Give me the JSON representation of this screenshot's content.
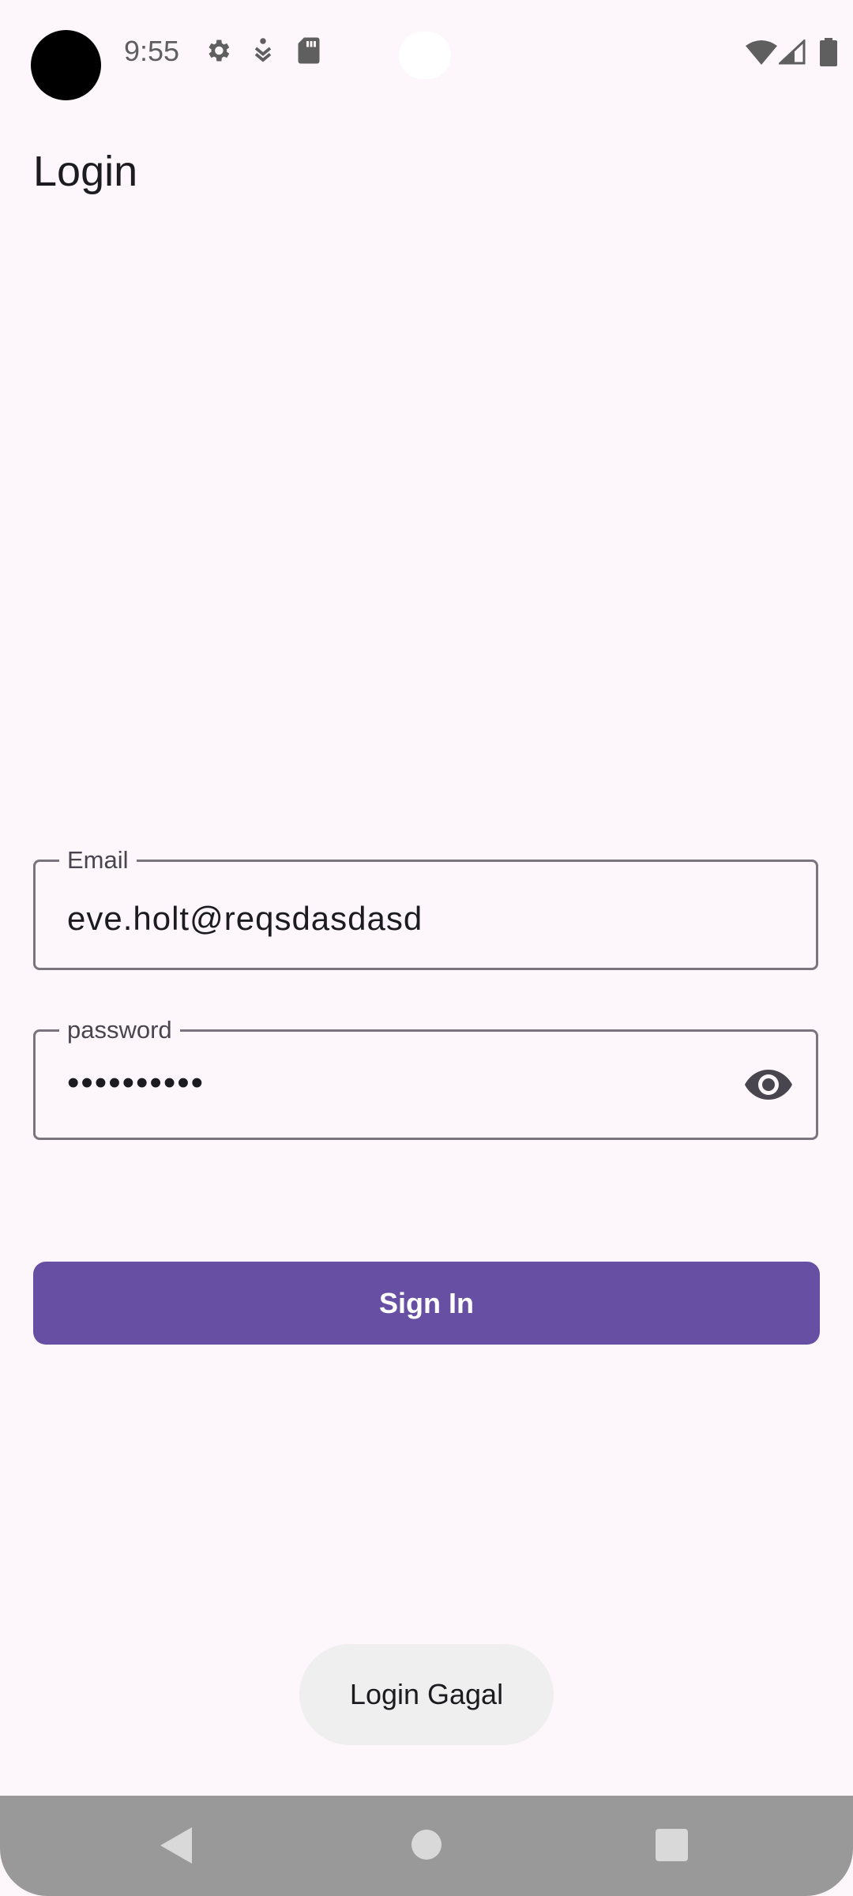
{
  "status_bar": {
    "time": "9:55",
    "icons_left": [
      "gear-icon",
      "accessibility-icon",
      "sd-card-icon"
    ],
    "icons_right": [
      "wifi-icon",
      "signal-icon",
      "battery-icon"
    ]
  },
  "header": {
    "title": "Login"
  },
  "form": {
    "email": {
      "label": "Email",
      "value": "eve.holt@reqsdasdasd"
    },
    "password": {
      "label": "password",
      "value": "••••••••••",
      "toggle_icon": "eye-icon"
    },
    "submit_label": "Sign In"
  },
  "toast": {
    "message": "Login Gagal"
  },
  "nav_bar": {
    "buttons": [
      "back",
      "home",
      "recents"
    ]
  },
  "colors": {
    "background": "#fdf7fb",
    "primary": "#6750a4",
    "outline": "#79747e",
    "toast_bg": "#efefef",
    "nav_bg": "#999999"
  }
}
